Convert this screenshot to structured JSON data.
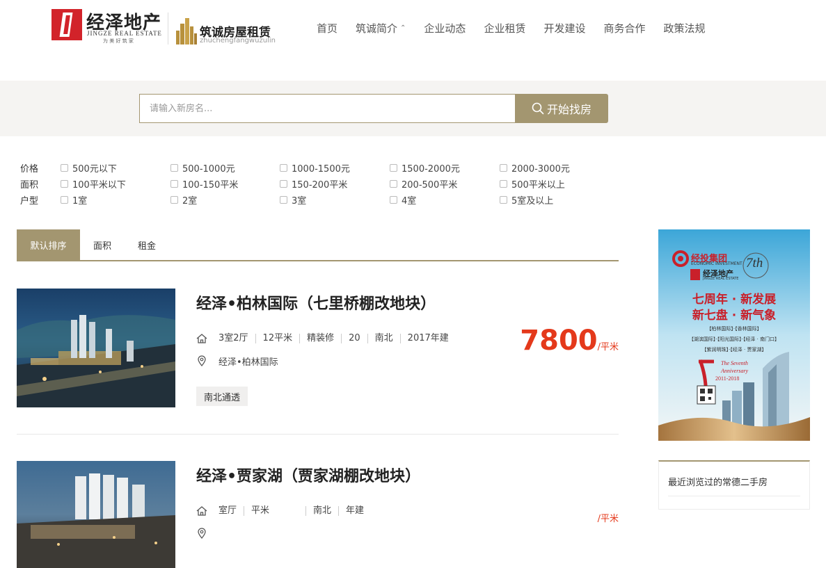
{
  "header": {
    "logo_cn": "经泽地产",
    "logo_en": "JINGZE REAL ESTATE",
    "logo_slogan": "为 美 好 筑 家",
    "sub_logo_cn": "筑诚房屋租赁",
    "sub_logo_en": "zhuchengfangwuzulin",
    "nav": [
      {
        "label": "首页"
      },
      {
        "label": "筑诚简介",
        "chevron": "⌃"
      },
      {
        "label": "企业动态"
      },
      {
        "label": "企业租赁"
      },
      {
        "label": "开发建设"
      },
      {
        "label": "商务合作"
      },
      {
        "label": "政策法规"
      }
    ]
  },
  "search": {
    "placeholder": "请输入新房名...",
    "button_label": "开始找房"
  },
  "filters": {
    "groups": [
      {
        "label": "价格",
        "options": [
          "500元以下",
          "500-1000元",
          "1000-1500元",
          "1500-2000元",
          "2000-3000元"
        ]
      },
      {
        "label": "面积",
        "options": [
          "100平米以下",
          "100-150平米",
          "150-200平米",
          "200-500平米",
          "500平米以上"
        ]
      },
      {
        "label": "户型",
        "options": [
          "1室",
          "2室",
          "3室",
          "4室",
          "5室及以上"
        ]
      }
    ]
  },
  "sort": {
    "tabs": [
      "默认排序",
      "面积",
      "租金"
    ],
    "active_index": 0
  },
  "listings": [
    {
      "title": "经泽•柏林国际（七里桥棚改地块）",
      "meta": [
        "3室2厅",
        "12平米",
        "精装修",
        "20",
        "南北",
        "2017年建"
      ],
      "location": "经泽•柏林国际",
      "tag": "南北通透",
      "price": "7800",
      "price_unit": "/平米"
    },
    {
      "title": "经泽•贾家湖（贾家湖棚改地块）",
      "meta": [
        "室厅",
        "平米",
        "",
        "",
        "南北",
        "年建"
      ],
      "location": "",
      "tag": "",
      "price": "",
      "price_unit": "/平米"
    }
  ],
  "sidebar": {
    "ad": {
      "group_name": "经投集团",
      "group_en": "ECONOMIC INVESTMENT",
      "brand": "经泽地产",
      "brand_en": "JINGZE REAL ESTATE",
      "badge": "7th",
      "headline_1": "七周年 · 新发展",
      "headline_2": "新七盘 · 新气象",
      "projects_1": "【柏林国际】·【香林国际】",
      "projects_2": "【湖滨国际】·【阳光国际】·【经泽 · 南门口】",
      "projects_3": "【紫润明珠】·【经泽 · 贾家湖】",
      "anniv_1": "The Seventh",
      "anniv_2": "Anniversary",
      "anniv_3": "2011-2018"
    },
    "recent_title": "最近浏览过的常德二手房"
  },
  "colors": {
    "accent": "#a39670",
    "price": "#e4391b",
    "brand_red": "#d2232a"
  }
}
